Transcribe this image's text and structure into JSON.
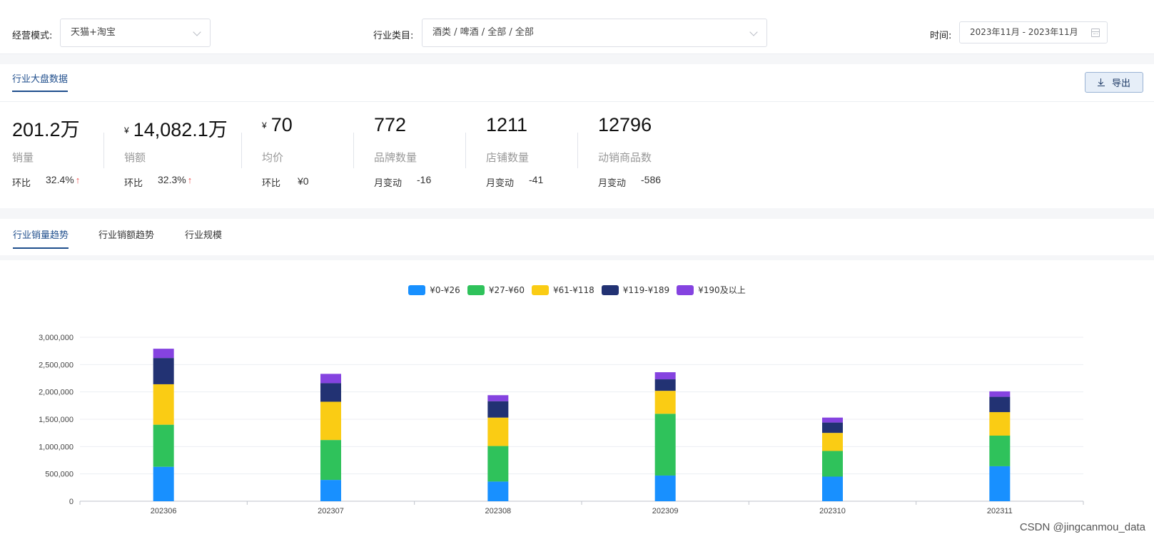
{
  "filters": {
    "mode_label": "经营模式:",
    "mode_value": "天猫+淘宝",
    "category_label": "行业类目:",
    "category_value": "酒类 / 啤酒 / 全部 / 全部",
    "time_label": "时间:",
    "time_value": "2023年11月 - 2023年11月"
  },
  "kpi_panel": {
    "tab": "行业大盘数据",
    "export_label": "导出",
    "currency_symbol": "¥",
    "items": [
      {
        "value": "201.2万",
        "label": "销量",
        "delta_label": "环比",
        "delta_value": "32.4%",
        "trend": "up"
      },
      {
        "value": "14,082.1万",
        "label": "销额",
        "delta_label": "环比",
        "delta_value": "32.3%",
        "trend": "up"
      },
      {
        "value": "70",
        "label": "均价",
        "delta_label": "环比",
        "delta_value": "¥0"
      },
      {
        "value": "772",
        "label": "品牌数量",
        "delta_label": "月变动",
        "delta_value": "-16"
      },
      {
        "value": "1211",
        "label": "店铺数量",
        "delta_label": "月变动",
        "delta_value": "-41"
      },
      {
        "value": "12796",
        "label": "动销商品数",
        "delta_label": "月变动",
        "delta_value": "-586"
      }
    ],
    "up_glyph": "↑"
  },
  "trend_tabs": [
    {
      "label": "行业销量趋势",
      "active": true
    },
    {
      "label": "行业销额趋势",
      "active": false
    },
    {
      "label": "行业规模",
      "active": false
    }
  ],
  "colors": {
    "accent": "#1f4e8c",
    "series": [
      "#1890ff",
      "#2fc25b",
      "#facc14",
      "#223273",
      "#8543e0"
    ]
  },
  "chart_data": {
    "type": "bar",
    "stacked": true,
    "categories": [
      "202306",
      "202307",
      "202308",
      "202309",
      "202310",
      "202311"
    ],
    "series": [
      {
        "name": "¥0-¥26",
        "values": [
          630000,
          390000,
          360000,
          470000,
          450000,
          640000
        ]
      },
      {
        "name": "¥27-¥60",
        "values": [
          770000,
          730000,
          650000,
          1130000,
          470000,
          560000
        ]
      },
      {
        "name": "¥61-¥118",
        "values": [
          740000,
          700000,
          520000,
          420000,
          330000,
          430000
        ]
      },
      {
        "name": "¥119-¥189",
        "values": [
          480000,
          340000,
          300000,
          210000,
          190000,
          280000
        ]
      },
      {
        "name": "¥190及以上",
        "values": [
          170000,
          170000,
          110000,
          130000,
          90000,
          100000
        ]
      }
    ],
    "ylim": [
      0,
      3000000
    ],
    "yticks": [
      "0",
      "500,000",
      "1,000,000",
      "1,500,000",
      "2,000,000",
      "2,500,000",
      "3,000,000"
    ],
    "grid": true,
    "legend_position": "top-center"
  },
  "watermark": "CSDN @jingcanmou_data"
}
